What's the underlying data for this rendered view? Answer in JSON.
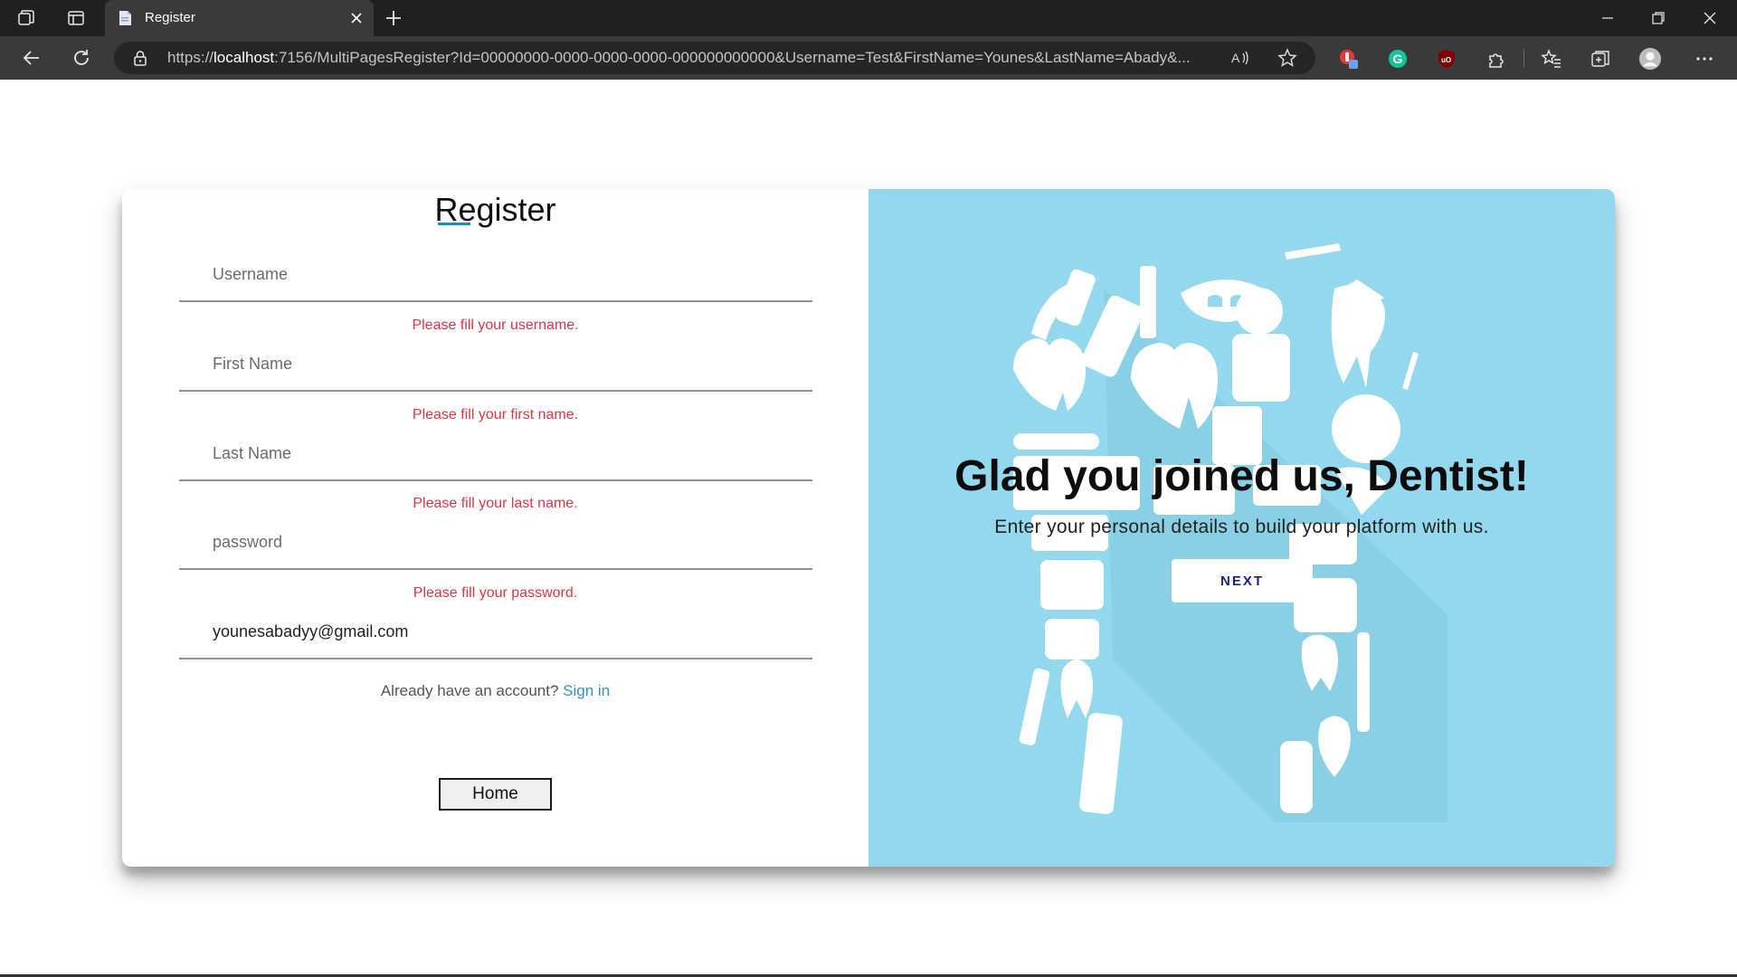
{
  "browser": {
    "tab_title": "Register",
    "url_prefix": "https://",
    "url_host": "localhost",
    "url_rest": ":7156/MultiPagesRegister?Id=00000000-0000-0000-0000-000000000000&Username=Test&FirstName=Younes&LastName=Abady&..."
  },
  "form": {
    "title": "Register",
    "username_placeholder": "Username",
    "username_error": "Please fill your username.",
    "firstname_placeholder": "First Name",
    "firstname_error": "Please fill your first name.",
    "lastname_placeholder": "Last Name",
    "lastname_error": "Please fill your last name.",
    "password_placeholder": "password",
    "password_error": "Please fill your password.",
    "email_value": "younesabadyy@gmail.com",
    "signin_prompt": "Already have an account?",
    "signin_link": "Sign in",
    "home_button": "Home"
  },
  "panel": {
    "heading": "Glad you joined us, Dentist!",
    "subtext": "Enter your personal details to build your platform with us.",
    "next_button": "NEXT"
  },
  "colors": {
    "panel_bg": "#93d8ec",
    "error": "#dc3545",
    "link": "#3a8fc0",
    "next_text": "#1a237e"
  },
  "icons": {
    "tab_actions": "tab-actions-icon",
    "vertical_tabs": "vertical-tabs-icon",
    "back": "back-arrow-icon",
    "refresh": "refresh-icon",
    "lock": "lock-icon",
    "read_aloud": "read-aloud-icon",
    "favorite": "star-icon",
    "extensions": "puzzle-icon",
    "favorites": "favorites-icon",
    "collections": "collections-icon",
    "profile": "profile-icon",
    "menu": "more-icon"
  }
}
